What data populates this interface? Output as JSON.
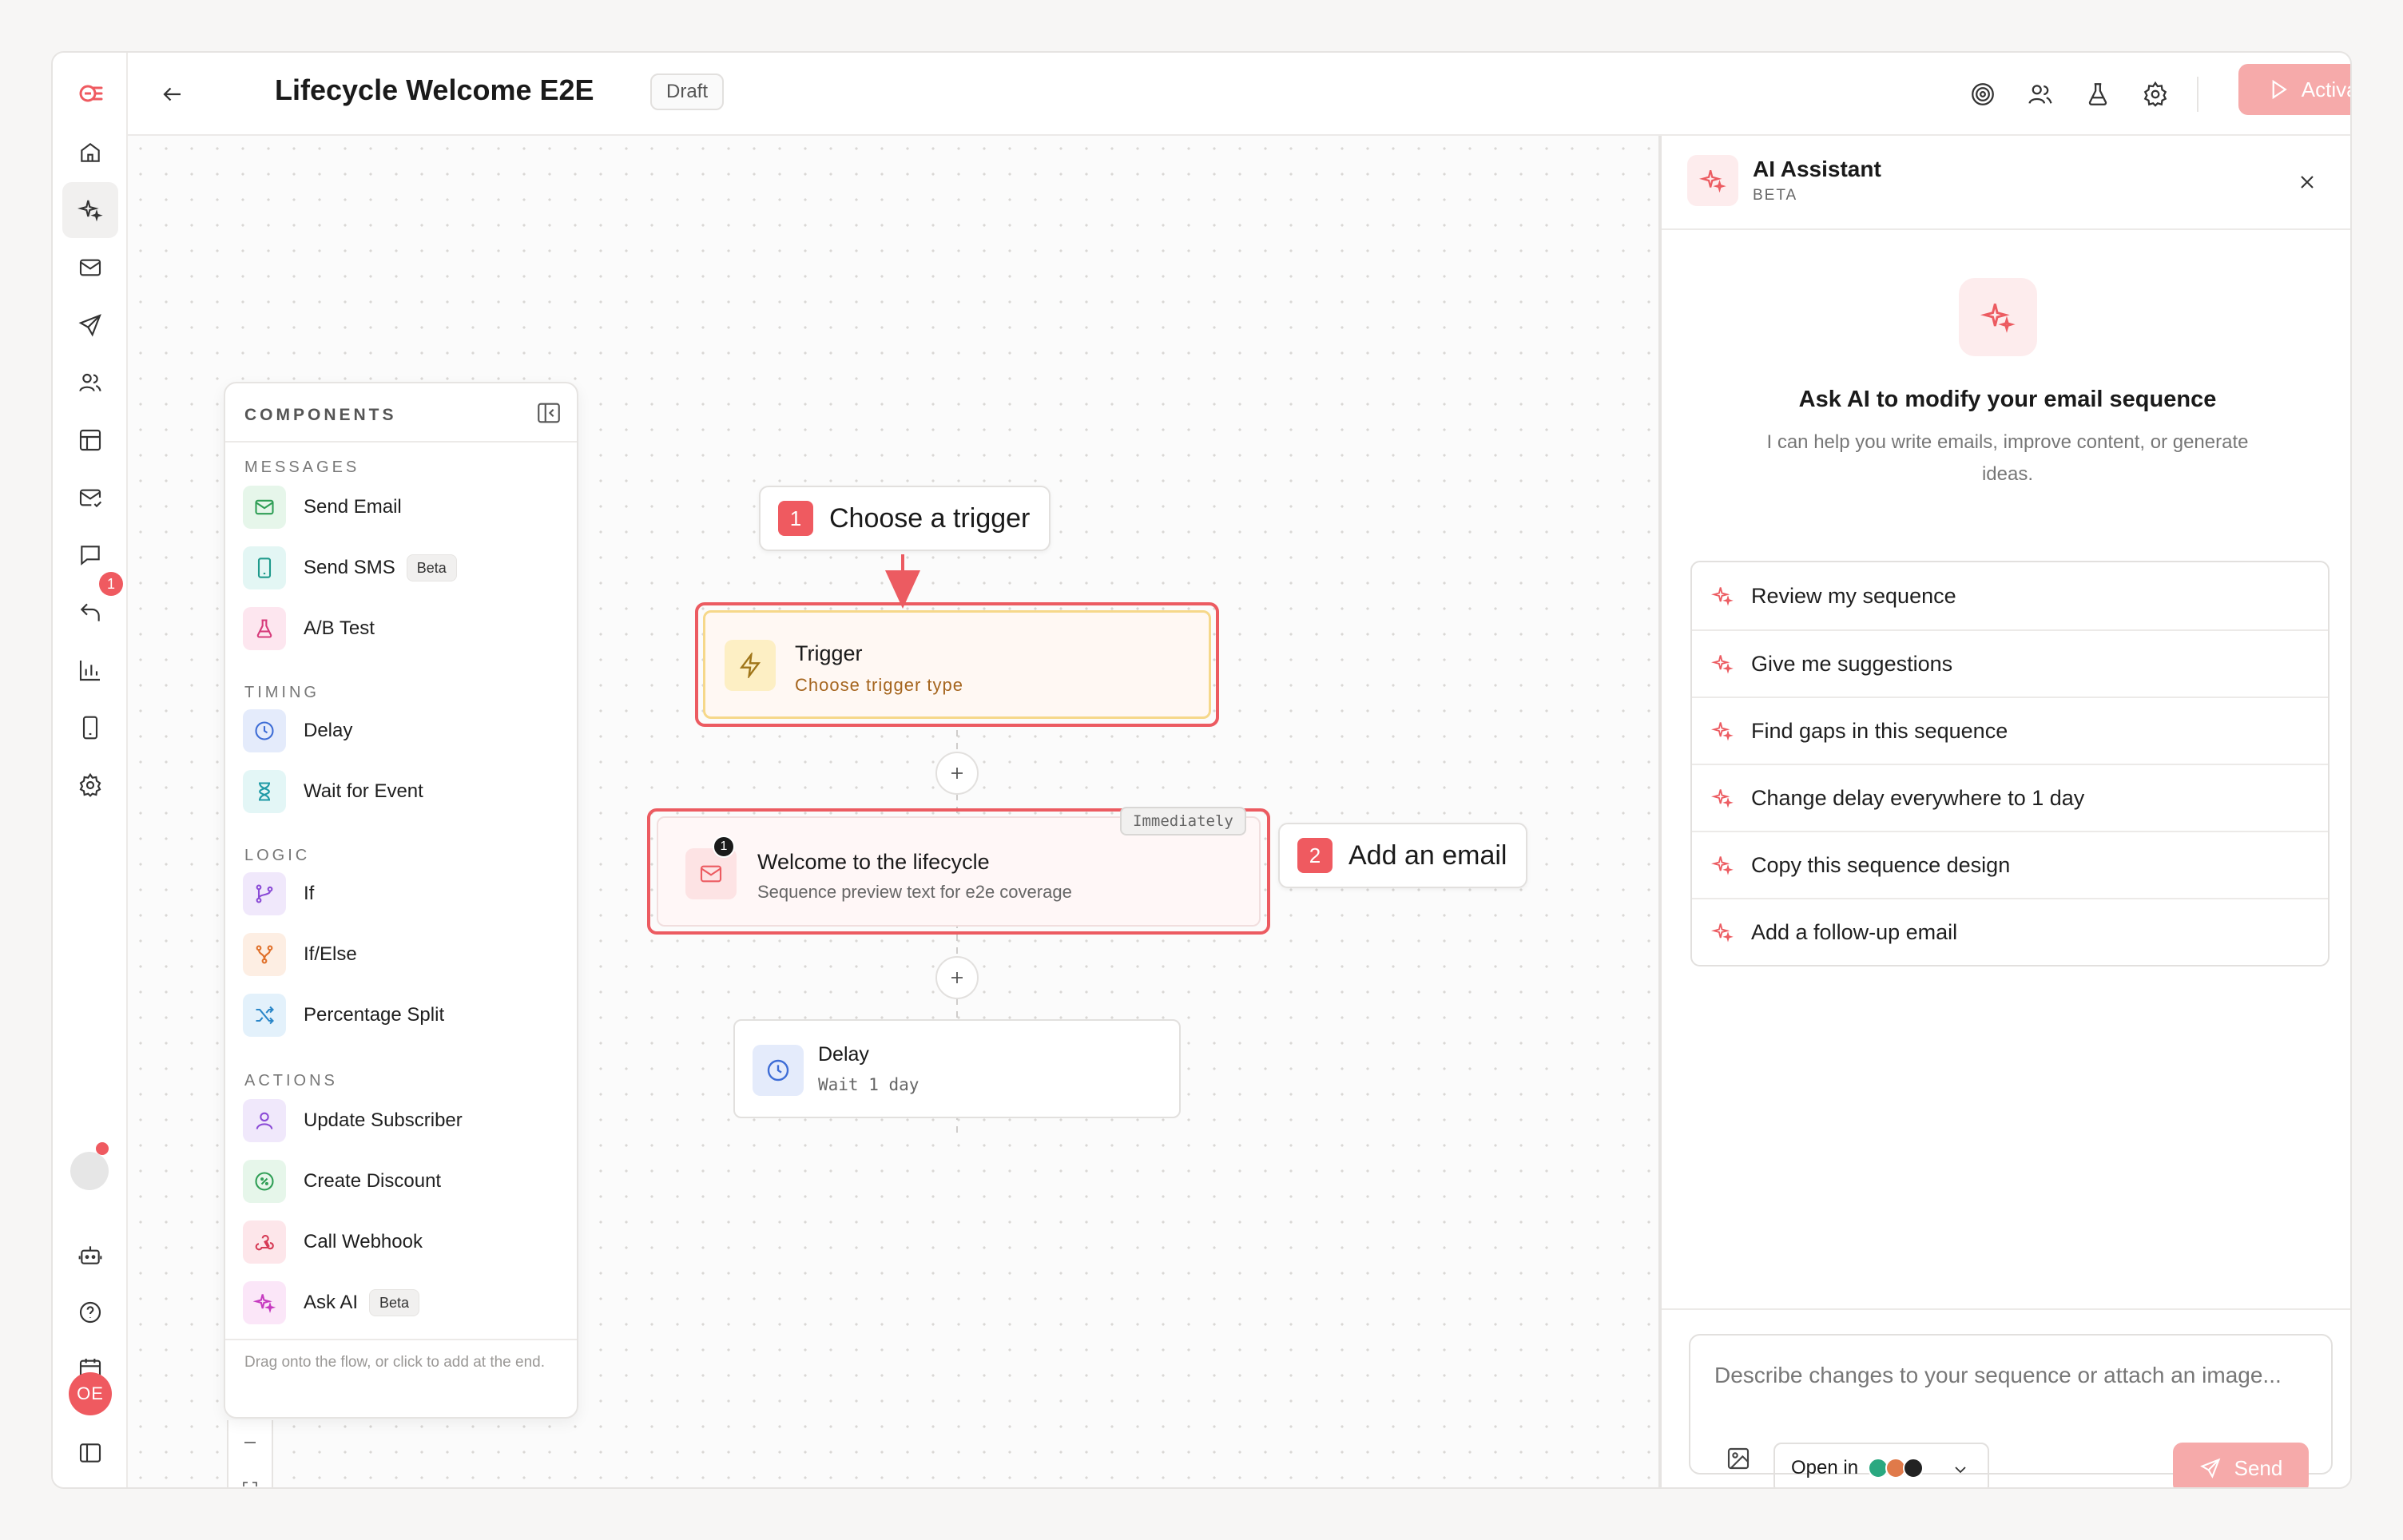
{
  "header": {
    "title": "Lifecycle Welcome E2E",
    "status": "Draft",
    "activate_label": "Activate"
  },
  "rail": {
    "badge_count": "1",
    "avatar_initials": "OE"
  },
  "components": {
    "heading": "COMPONENTS",
    "sections": {
      "messages": "MESSAGES",
      "timing": "TIMING",
      "logic": "LOGIC",
      "actions": "ACTIONS"
    },
    "items": {
      "send_email": "Send Email",
      "send_sms": "Send SMS",
      "ab_test": "A/B Test",
      "delay": "Delay",
      "wait_for_event": "Wait for Event",
      "if": "If",
      "if_else": "If/Else",
      "percentage_split": "Percentage Split",
      "update_subscriber": "Update Subscriber",
      "create_discount": "Create Discount",
      "call_webhook": "Call Webhook",
      "ask_ai": "Ask AI"
    },
    "beta_label": "Beta",
    "footer": "Drag onto the flow, or click to add at the end."
  },
  "flow": {
    "callout_trigger": {
      "number": "1",
      "text": "Choose a trigger"
    },
    "callout_email": {
      "number": "2",
      "text": "Add an email"
    },
    "trigger_node": {
      "title": "Trigger",
      "subtitle": "Choose trigger type"
    },
    "email_node": {
      "badge": "Immediately",
      "count": "1",
      "title": "Welcome to the lifecycle",
      "subtitle": "Sequence preview text for e2e coverage"
    },
    "delay_node": {
      "title": "Delay",
      "subtitle": "Wait 1 day"
    }
  },
  "ai_assistant": {
    "title": "AI Assistant",
    "beta": "BETA",
    "heading": "Ask AI to modify your email sequence",
    "description": "I can help you write emails, improve content, or generate ideas.",
    "suggestions": [
      "Review my sequence",
      "Give me suggestions",
      "Find gaps in this sequence",
      "Change delay everywhere to 1 day",
      "Copy this sequence design",
      "Add a follow-up email"
    ],
    "input_placeholder": "Describe changes to your sequence or attach an image...",
    "open_in_label": "Open in",
    "send_label": "Send"
  },
  "colors": {
    "accent": "#ef5a60",
    "accent_light": "#f6aaaa",
    "trigger_border": "#f6d88a"
  }
}
